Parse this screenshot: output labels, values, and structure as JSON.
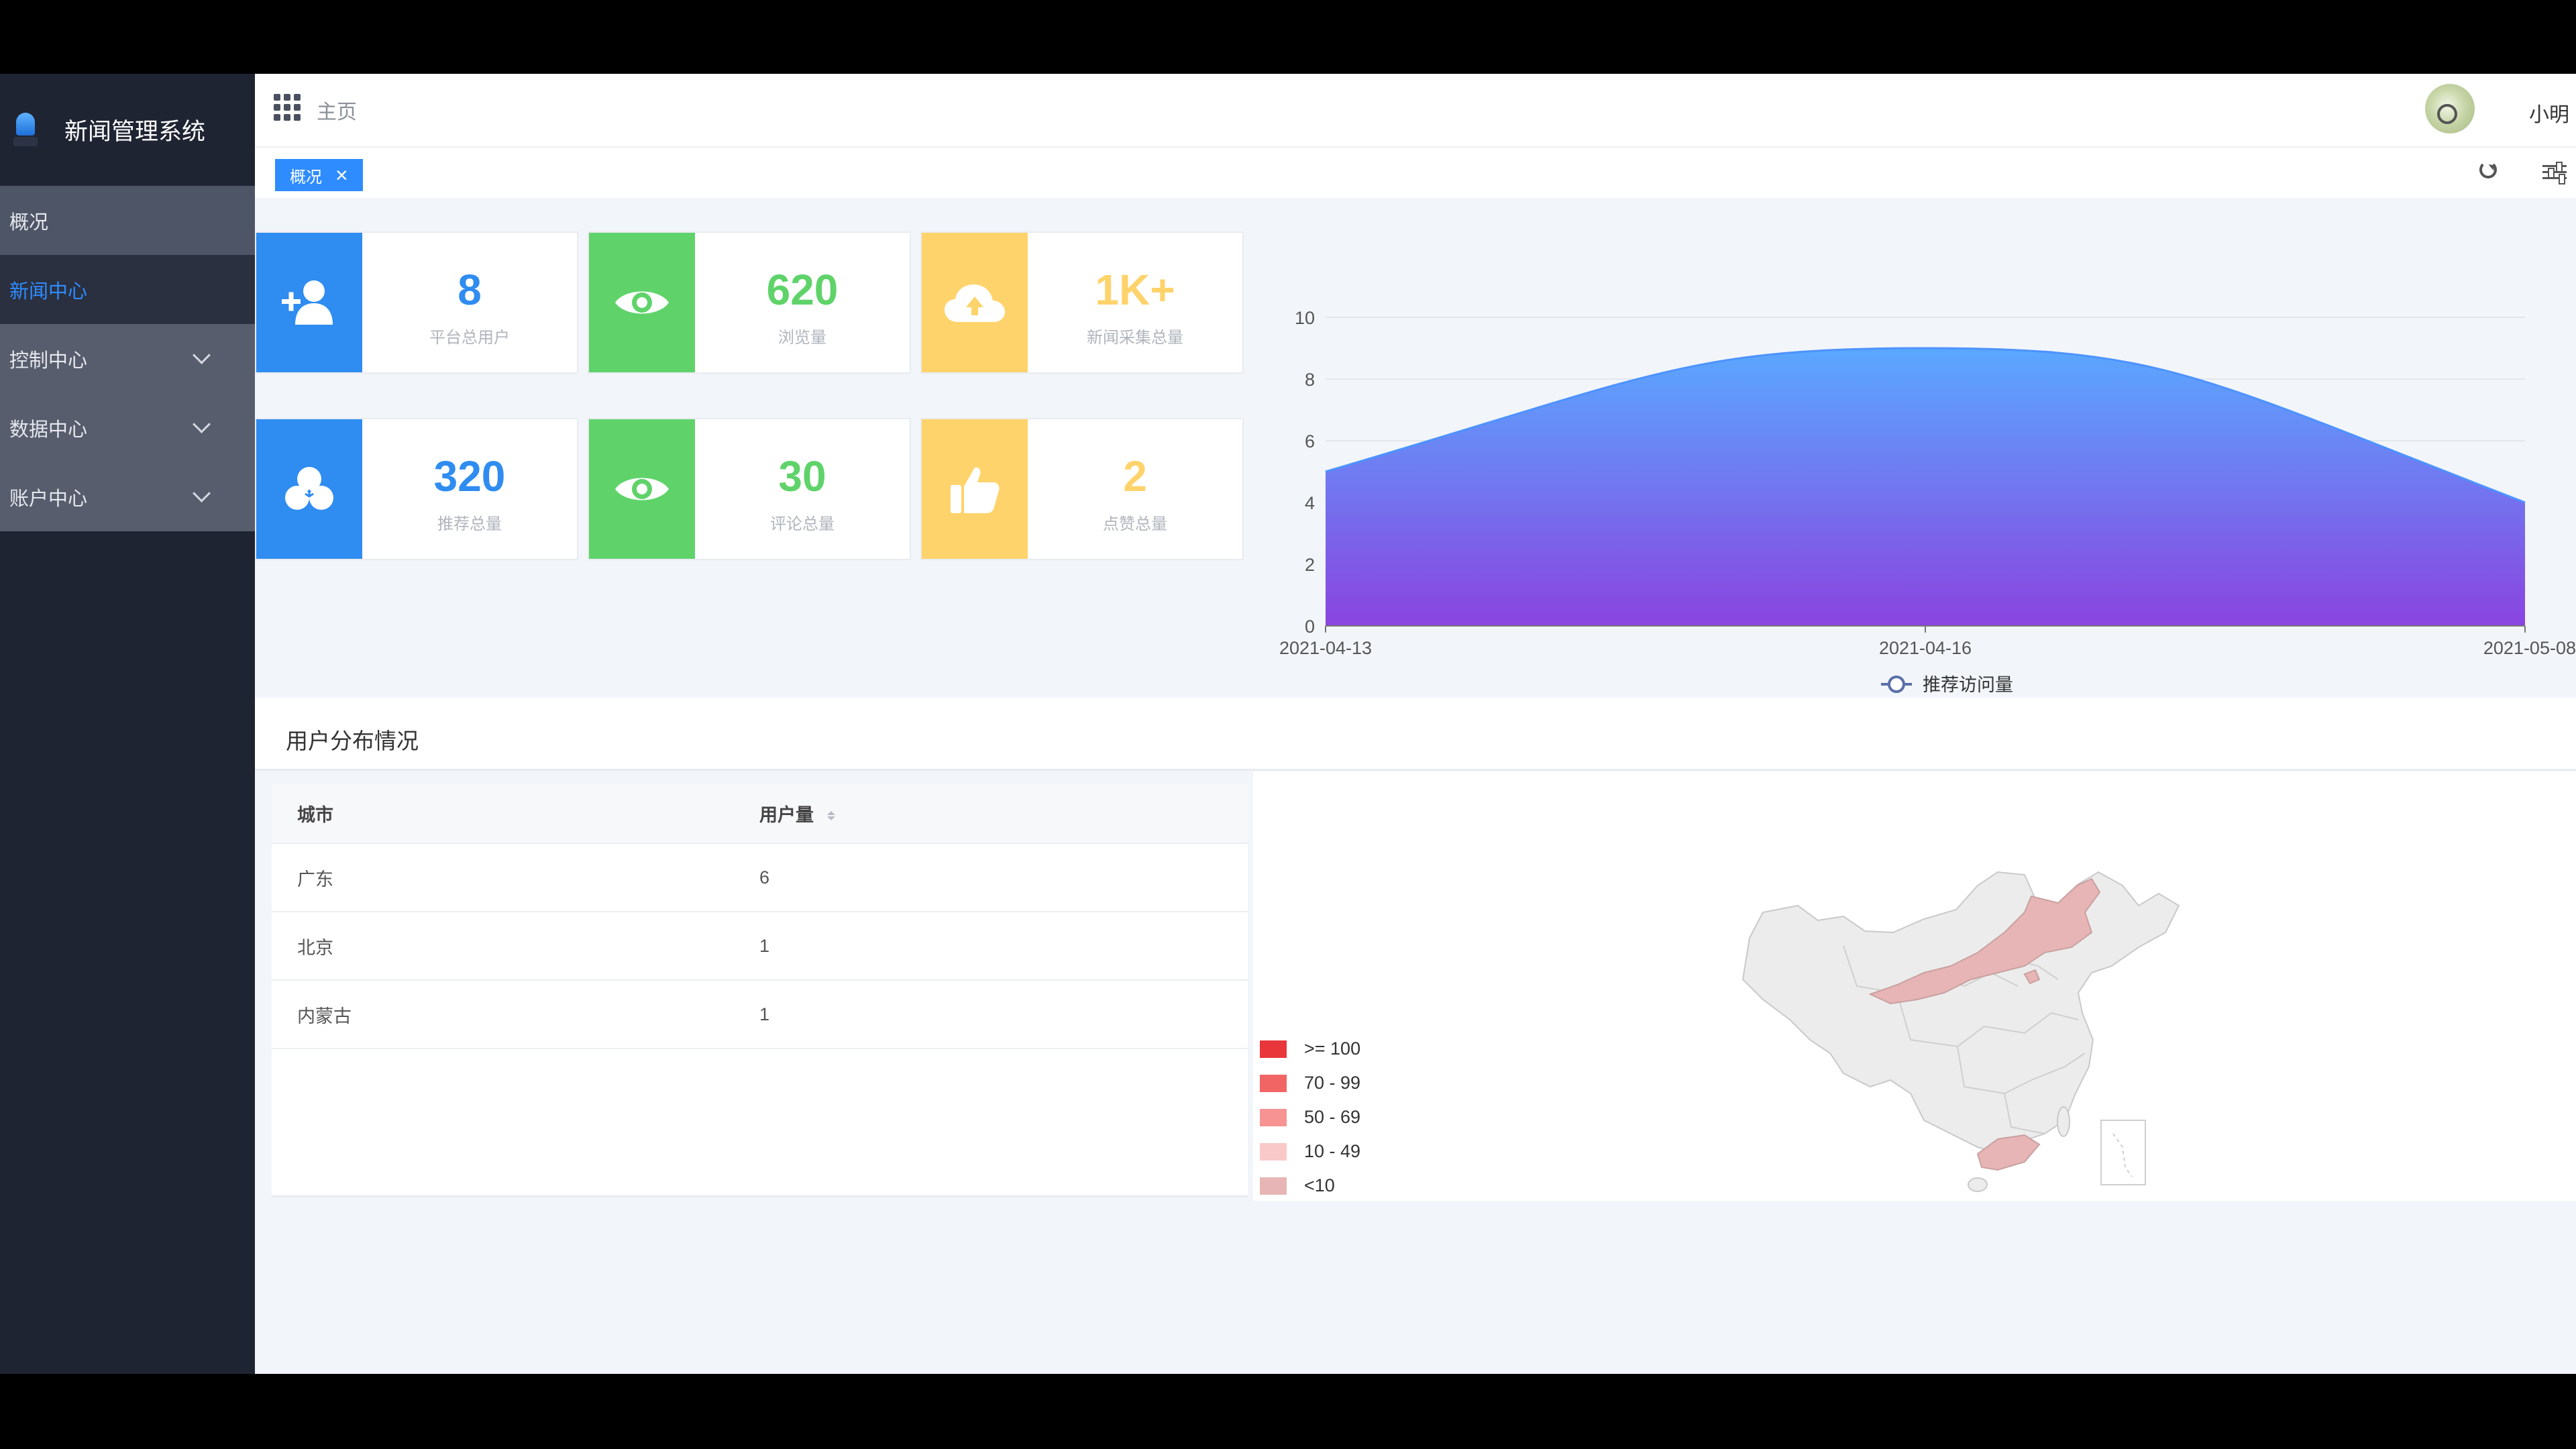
{
  "app": {
    "title": "新闻管理系统"
  },
  "sidebar": {
    "items": [
      {
        "label": "概况"
      },
      {
        "label": "新闻中心"
      },
      {
        "label": "控制中心"
      },
      {
        "label": "数据中心"
      },
      {
        "label": "账户中心"
      }
    ]
  },
  "header": {
    "breadcrumb": "主页",
    "username": "小明"
  },
  "tabs": [
    {
      "label": "概况"
    }
  ],
  "stats": [
    {
      "value": "8",
      "label": "平台总用户",
      "icon": "add-user-icon",
      "color": "#2f8cf0"
    },
    {
      "value": "620",
      "label": "浏览量",
      "icon": "eye-icon",
      "color": "#5fd36a"
    },
    {
      "value": "1K+",
      "label": "新闻采集总量",
      "icon": "cloud-upload-icon",
      "color": "#ffd36b"
    },
    {
      "value": "320",
      "label": "推荐总量",
      "icon": "circles-icon",
      "color": "#2f8cf0"
    },
    {
      "value": "30",
      "label": "评论总量",
      "icon": "eye-icon",
      "color": "#5fd36a"
    },
    {
      "value": "2",
      "label": "点赞总量",
      "icon": "thumbs-up-icon",
      "color": "#ffd36b"
    }
  ],
  "chart_data": {
    "type": "area",
    "x": [
      "2021-04-13",
      "2021-04-16",
      "2021-05-08"
    ],
    "series": [
      {
        "name": "推荐访问量",
        "values": [
          5,
          9,
          4
        ]
      }
    ],
    "yticks": [
      0,
      2,
      4,
      6,
      8,
      10
    ],
    "ylim": [
      0,
      10
    ],
    "grid": true,
    "legend": "bottom-center",
    "gradient": [
      "#5aa8ff",
      "#8a44e0"
    ]
  },
  "distribution": {
    "title": "用户分布情况",
    "columns": [
      "城市",
      "用户量"
    ],
    "rows": [
      {
        "city": "广东",
        "count": "6"
      },
      {
        "city": "北京",
        "count": "1"
      },
      {
        "city": "内蒙古",
        "count": "1"
      }
    ],
    "map_legend": [
      {
        "label": ">= 100",
        "color": "#e8363a"
      },
      {
        "label": "70 - 99",
        "color": "#f26565"
      },
      {
        "label": "50 - 69",
        "color": "#f79393"
      },
      {
        "label": "10 - 49",
        "color": "#f9c9c9"
      },
      {
        "label": "<10",
        "color": "#e7b5b5"
      }
    ]
  }
}
